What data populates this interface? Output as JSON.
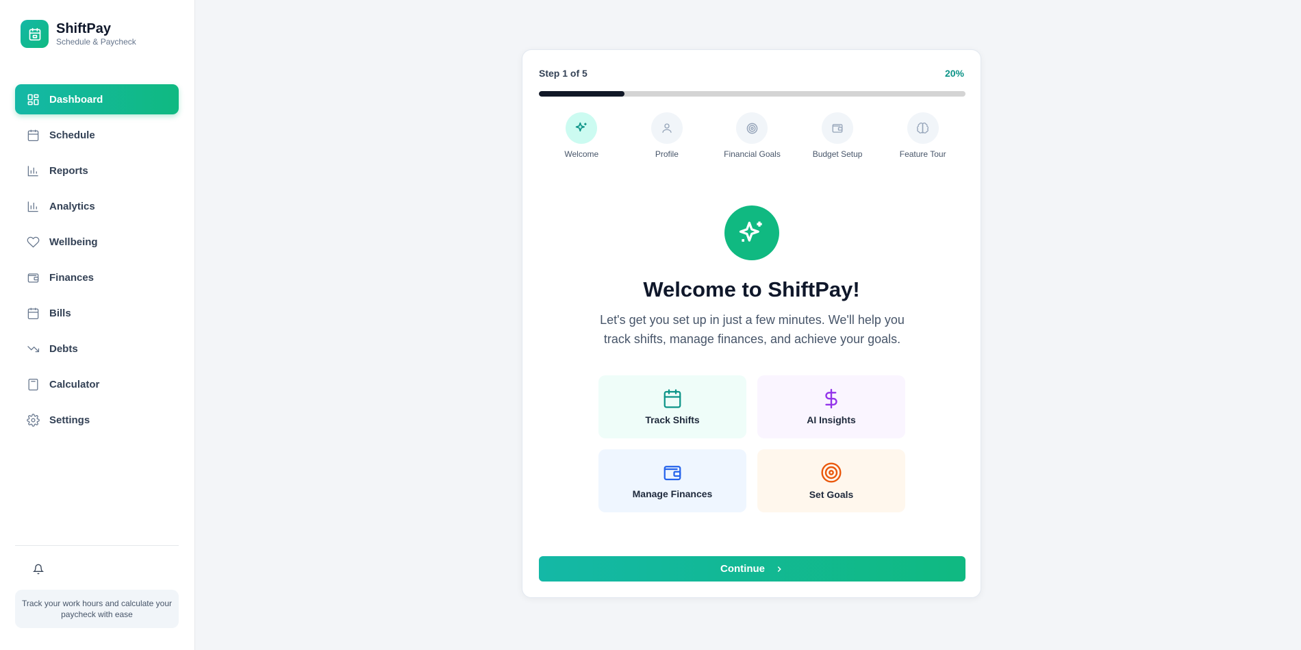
{
  "brand": {
    "name": "ShiftPay",
    "tagline": "Schedule & Paycheck",
    "icon": "calendar-icon"
  },
  "sidebar": {
    "items": [
      {
        "label": "Dashboard",
        "icon": "dashboard-icon",
        "active": true
      },
      {
        "label": "Schedule",
        "icon": "calendar-icon"
      },
      {
        "label": "Reports",
        "icon": "bar-chart-icon"
      },
      {
        "label": "Analytics",
        "icon": "bar-chart-icon"
      },
      {
        "label": "Wellbeing",
        "icon": "heart-icon"
      },
      {
        "label": "Finances",
        "icon": "wallet-icon"
      },
      {
        "label": "Bills",
        "icon": "calendar-icon"
      },
      {
        "label": "Debts",
        "icon": "trending-down-icon"
      },
      {
        "label": "Calculator",
        "icon": "calculator-icon"
      },
      {
        "label": "Settings",
        "icon": "gear-icon"
      }
    ],
    "tip": "Track your work hours and calculate your paycheck with ease"
  },
  "onboarding": {
    "step_label": "Step 1 of 5",
    "percent_label": "20%",
    "progress": 0.2,
    "steps": [
      {
        "label": "Welcome",
        "icon": "sparkles-icon",
        "active": true
      },
      {
        "label": "Profile",
        "icon": "user-icon"
      },
      {
        "label": "Financial Goals",
        "icon": "target-icon"
      },
      {
        "label": "Budget Setup",
        "icon": "wallet-icon"
      },
      {
        "label": "Feature Tour",
        "icon": "brain-icon"
      }
    ],
    "title": "Welcome to ShiftPay!",
    "subtitle": "Let's get you set up in just a few minutes. We'll help you track shifts, manage finances, and achieve your goals.",
    "features": [
      {
        "label": "Track Shifts",
        "icon": "calendar-icon",
        "color": "#0d9488"
      },
      {
        "label": "AI Insights",
        "icon": "dollar-icon",
        "color": "#9333ea"
      },
      {
        "label": "Manage Finances",
        "icon": "wallet-icon",
        "color": "#2563eb"
      },
      {
        "label": "Set Goals",
        "icon": "target-icon",
        "color": "#ea580c"
      }
    ],
    "continue_label": "Continue"
  },
  "colors": {
    "accent": "#10b981",
    "accent_dark": "#0d9488",
    "progress_fill": "#111827"
  }
}
